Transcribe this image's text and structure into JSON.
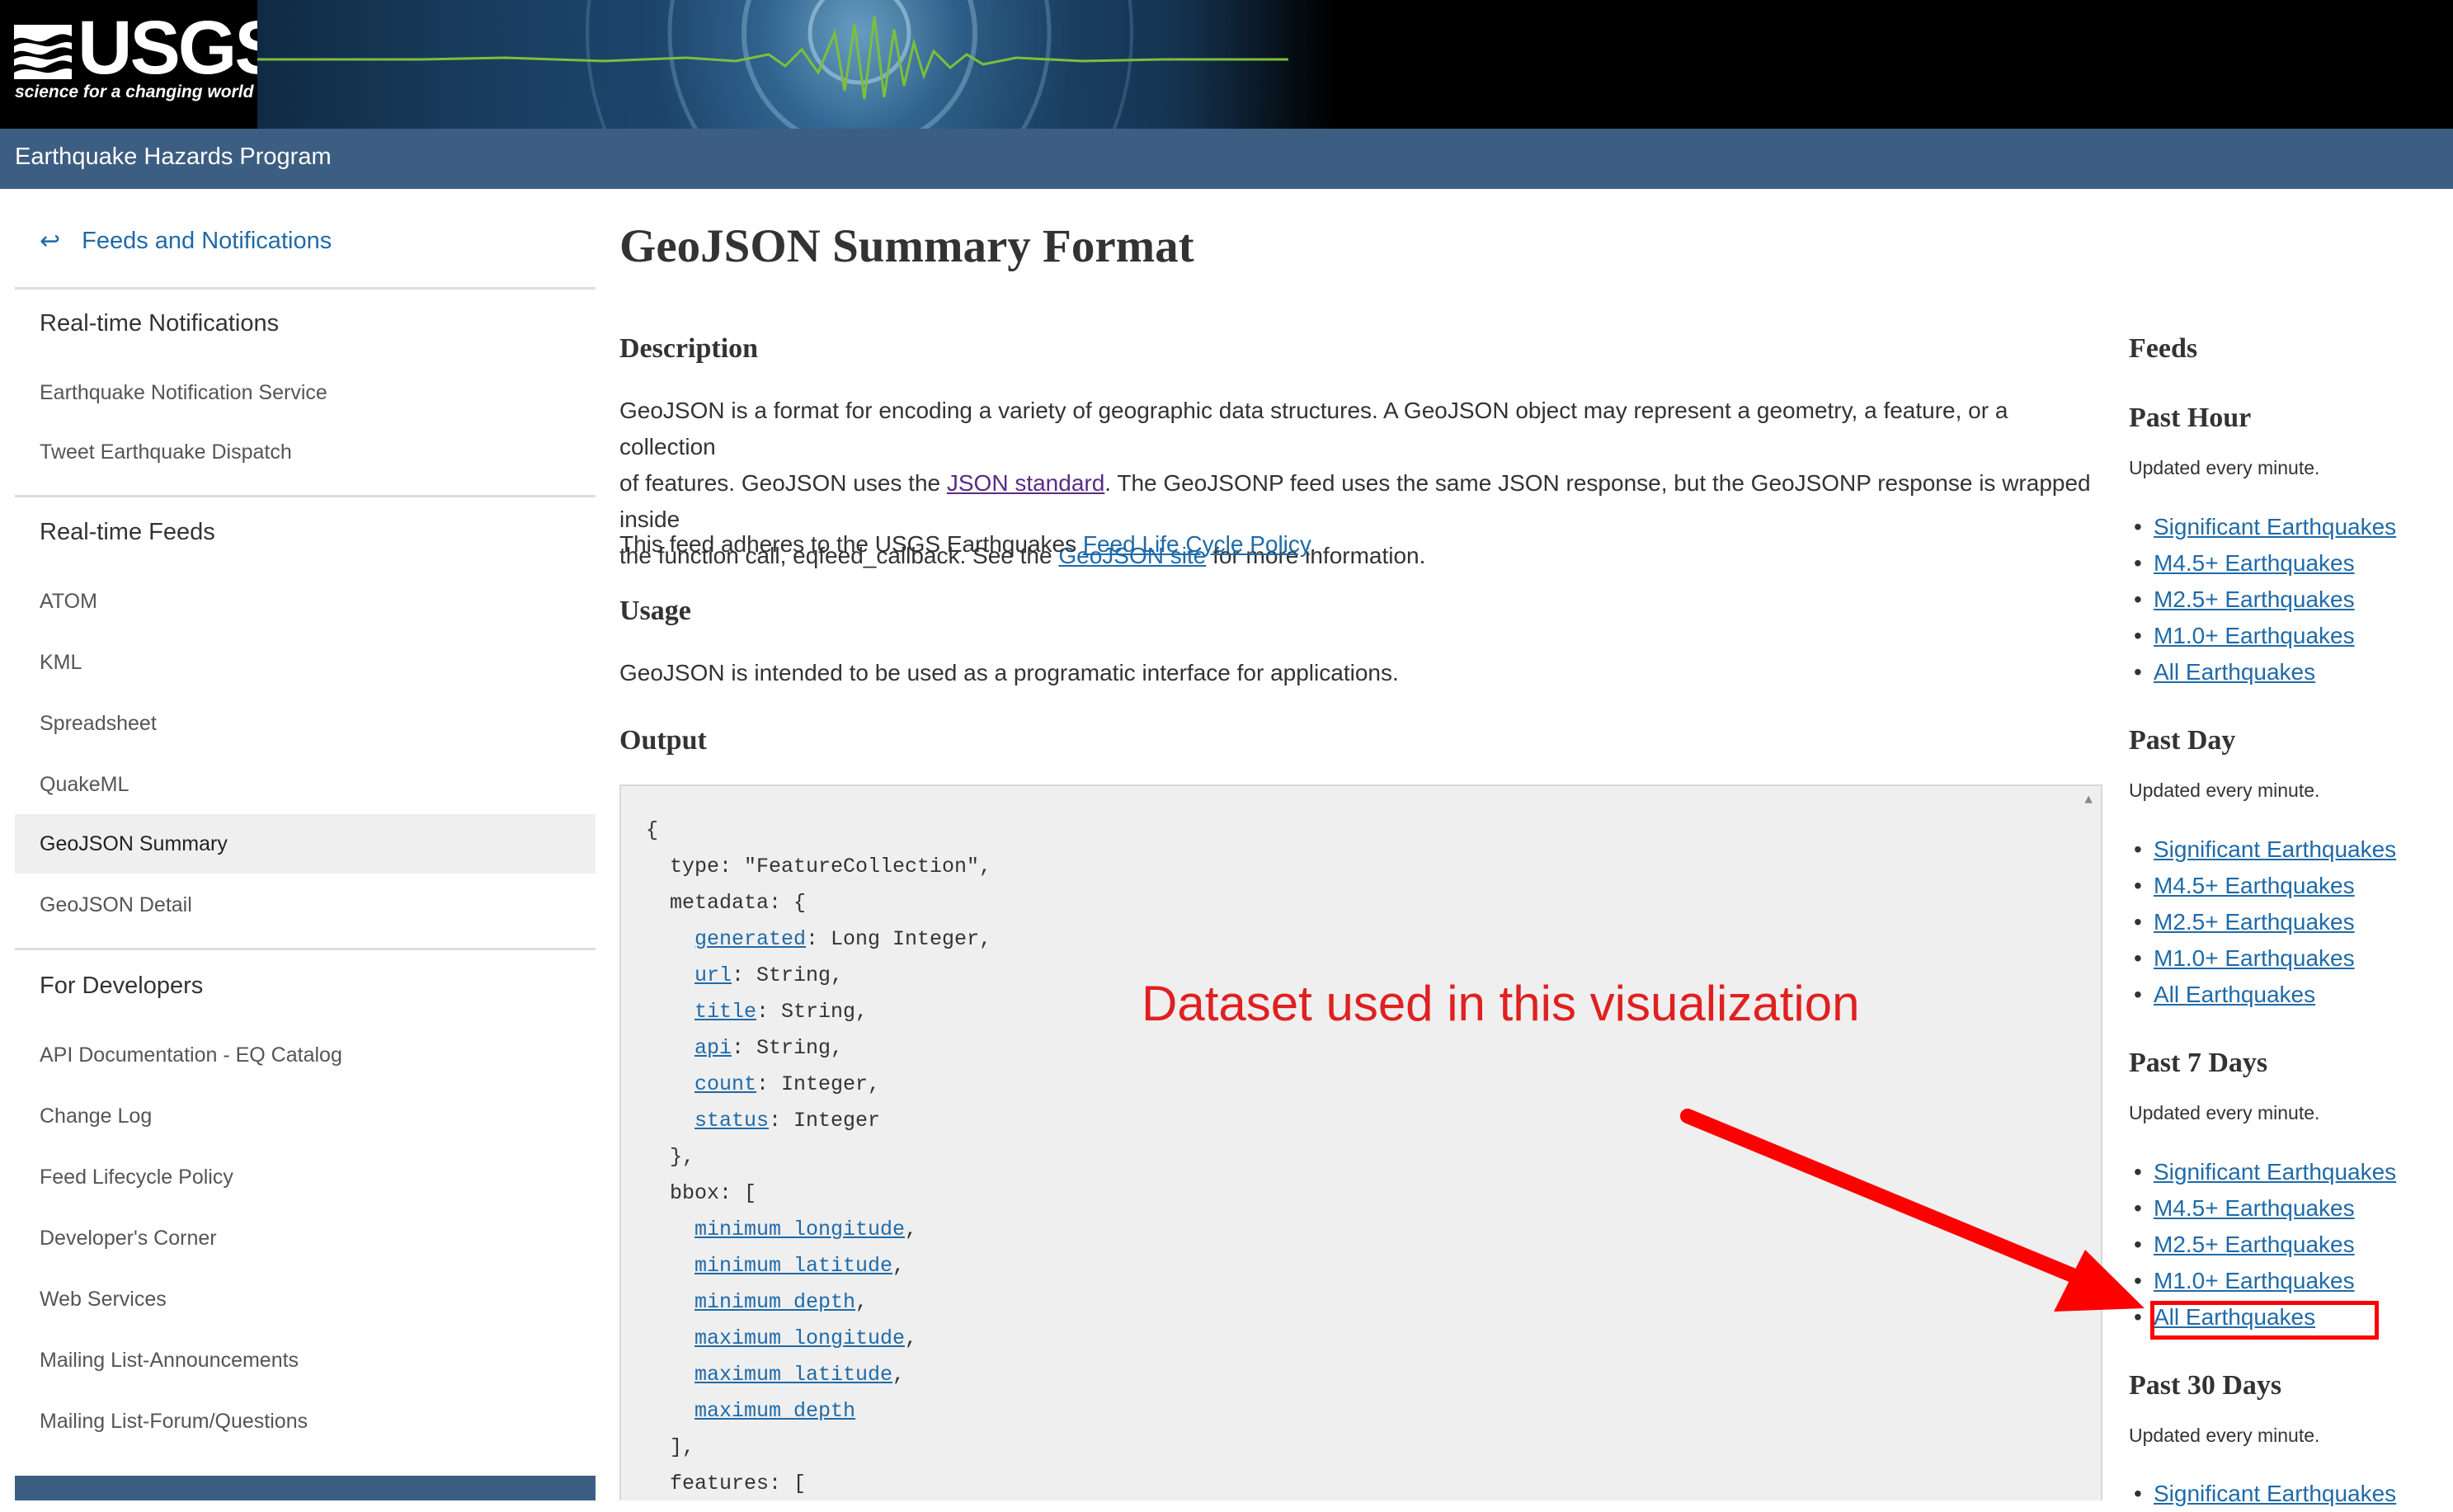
{
  "header": {
    "logo_text": "USGS",
    "logo_tagline": "science for a changing world",
    "program_title": "Earthquake Hazards Program"
  },
  "sidebar": {
    "back_link": "Feeds and Notifications",
    "back_icon": "arrow-back-icon",
    "sections": [
      {
        "title": "Real-time Notifications",
        "items": [
          "Earthquake Notification Service",
          "Tweet Earthquake Dispatch"
        ]
      },
      {
        "title": "Real-time Feeds",
        "items": [
          "ATOM",
          "KML",
          "Spreadsheet",
          "QuakeML",
          "GeoJSON Summary",
          "GeoJSON Detail"
        ]
      },
      {
        "title": "For Developers",
        "items": [
          "API Documentation - EQ Catalog",
          "Change Log",
          "Feed Lifecycle Policy",
          "Developer's Corner",
          "Web Services",
          "Mailing List-Announcements",
          "Mailing List-Forum/Questions"
        ]
      }
    ],
    "active_item": "GeoJSON Summary"
  },
  "main": {
    "title": "GeoJSON Summary Format",
    "description_heading": "Description",
    "desc_p1_a": "GeoJSON is a format for encoding a variety of geographic data structures. A GeoJSON object may represent a geometry, a feature, or a collection",
    "desc_p1_b": "of features. GeoJSON uses the ",
    "desc_link_json": "JSON standard",
    "desc_p1_c": ". The GeoJSONP feed uses the same JSON response, but the GeoJSONP response is wrapped inside",
    "desc_p1_d": "the function call, eqfeed_callback. See the ",
    "desc_link_geojson": "GeoJSON site",
    "desc_p1_e": " for more information.",
    "desc_p2_a": "This feed adheres to the USGS Earthquakes ",
    "desc_link_policy": "Feed Life Cycle Policy",
    "desc_p2_b": ".",
    "usage_heading": "Usage",
    "usage_text": "GeoJSON is intended to be used as a programatic interface for applications.",
    "output_heading": "Output",
    "code": {
      "l1": "{",
      "l2": "type: \"FeatureCollection\",",
      "l3": "metadata: {",
      "generated": "generated",
      "generated_t": ": Long Integer,",
      "url": "url",
      "url_t": ": String,",
      "title": "title",
      "title_t": ": String,",
      "api": "api",
      "api_t": ": String,",
      "count": "count",
      "count_t": ": Integer,",
      "status": "status",
      "status_t": ": Integer",
      "l10": "},",
      "l11": "bbox: [",
      "minlon": "minimum longitude",
      "minlat": "minimum latitude",
      "mindep": "minimum depth",
      "maxlon": "maximum longitude",
      "maxlat": "maximum latitude",
      "maxdep": "maximum depth",
      "comma": ",",
      "l18": "],",
      "l19": "features: ["
    },
    "annotation": "Dataset used in this visualization",
    "annotation_color": "#e02020"
  },
  "feeds": {
    "heading": "Feeds",
    "groups": [
      {
        "title": "Past Hour",
        "updated": "Updated every minute.",
        "links": [
          "Significant Earthquakes",
          "M4.5+ Earthquakes",
          "M2.5+ Earthquakes",
          "M1.0+ Earthquakes",
          "All Earthquakes"
        ]
      },
      {
        "title": "Past Day",
        "updated": "Updated every minute.",
        "links": [
          "Significant Earthquakes",
          "M4.5+ Earthquakes",
          "M2.5+ Earthquakes",
          "M1.0+ Earthquakes",
          "All Earthquakes"
        ]
      },
      {
        "title": "Past 7 Days",
        "updated": "Updated every minute.",
        "links": [
          "Significant Earthquakes",
          "M4.5+ Earthquakes",
          "M2.5+ Earthquakes",
          "M1.0+ Earthquakes",
          "All Earthquakes"
        ]
      },
      {
        "title": "Past 30 Days",
        "updated": "Updated every minute.",
        "links": [
          "Significant Earthquakes"
        ]
      }
    ],
    "bullet": "•"
  },
  "colors": {
    "link": "#1f6aa8",
    "program_bar": "#3c5e82",
    "highlight": "#ff0000"
  }
}
